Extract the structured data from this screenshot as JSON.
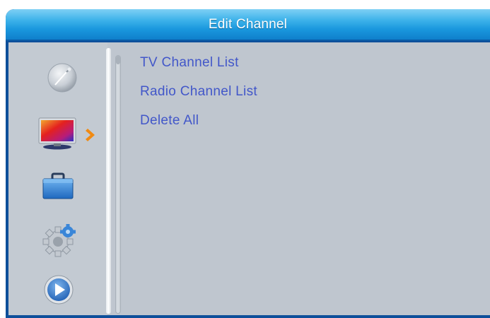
{
  "header": {
    "title": "Edit Channel"
  },
  "sidebar": {
    "icons": [
      {
        "name": "satellite-dish-icon",
        "selected": false
      },
      {
        "name": "tv-icon",
        "selected": true
      },
      {
        "name": "toolbox-icon",
        "selected": false
      },
      {
        "name": "gear-icon",
        "selected": false
      },
      {
        "name": "play-icon",
        "selected": false
      }
    ],
    "selected_indicator": "chevron-right-icon"
  },
  "menu": {
    "items": [
      {
        "label": "TV Channel List"
      },
      {
        "label": "Radio Channel List"
      },
      {
        "label": "Delete All"
      }
    ]
  },
  "colors": {
    "frame": "#0d4f9a",
    "title_bar": "#1a98de",
    "panel": "#bfc6cf",
    "menu_text": "#4257c9",
    "indicator": "#f08a12"
  }
}
